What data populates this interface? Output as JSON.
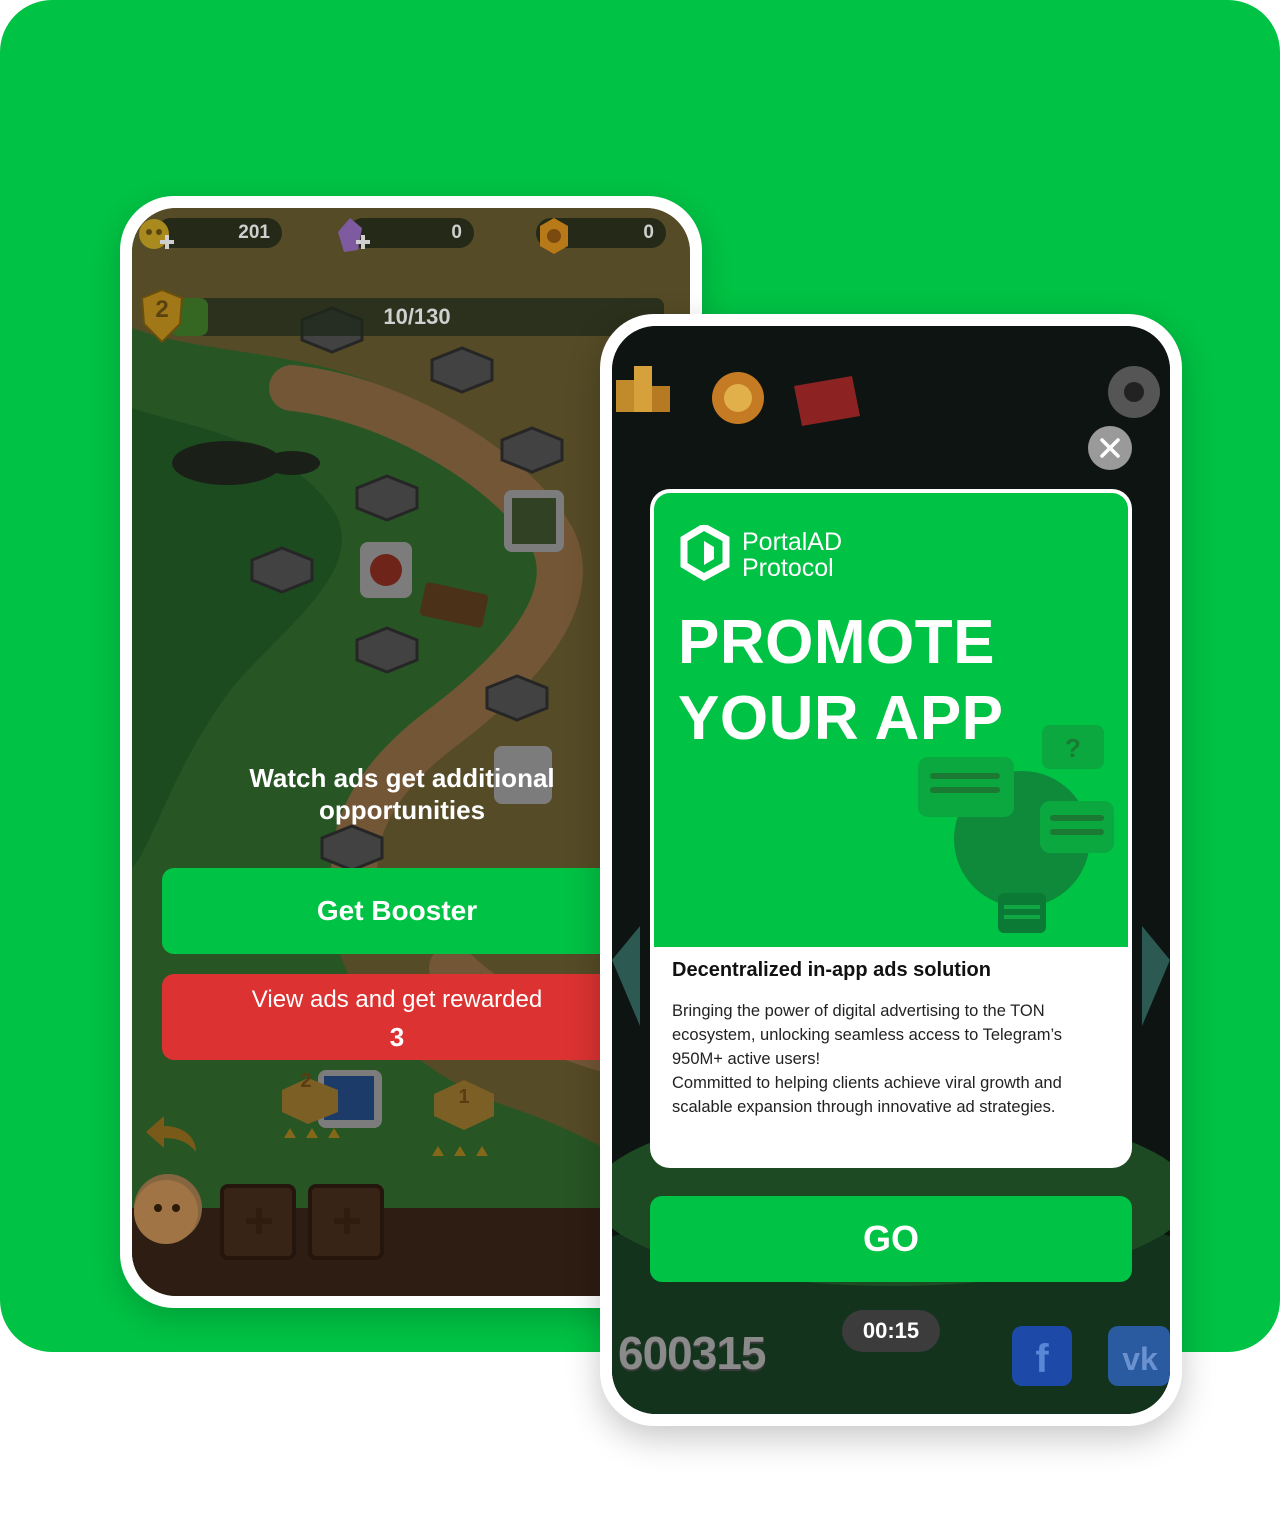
{
  "left_screen": {
    "counters": [
      {
        "icon": "skull-coin-icon",
        "value": "201"
      },
      {
        "icon": "crystal-icon",
        "value": "0"
      },
      {
        "icon": "gold-coin-icon",
        "value": "0"
      }
    ],
    "level": "2",
    "progress_text": "10/130",
    "progress": 0.077,
    "prompt": "Watch ads get additional opportunities",
    "booster_button": "Get Booster",
    "ads_button": {
      "label": "View ads and get rewarded",
      "count": "3"
    },
    "map_levels": [
      "2",
      "1"
    ]
  },
  "right_screen": {
    "brand": {
      "line1": "PortalAD",
      "line2": "Protocol"
    },
    "headline_line1": "PROMOTE",
    "headline_line2": "YOUR APP",
    "subtitle": "Decentralized in-app ads solution",
    "description": "Bringing the power of digital advertising to the TON ecosystem, unlocking seamless access to Telegram’s 950M+ active users!\nCommitted to helping clients achieve viral growth and scalable expansion through innovative ad strategies.",
    "go_button": "GO",
    "timer": "00:15",
    "score": "600315"
  },
  "colors": {
    "brand_green": "#00c244",
    "reward_red": "#dc3232",
    "timer_bg": "#3c3c3c"
  }
}
